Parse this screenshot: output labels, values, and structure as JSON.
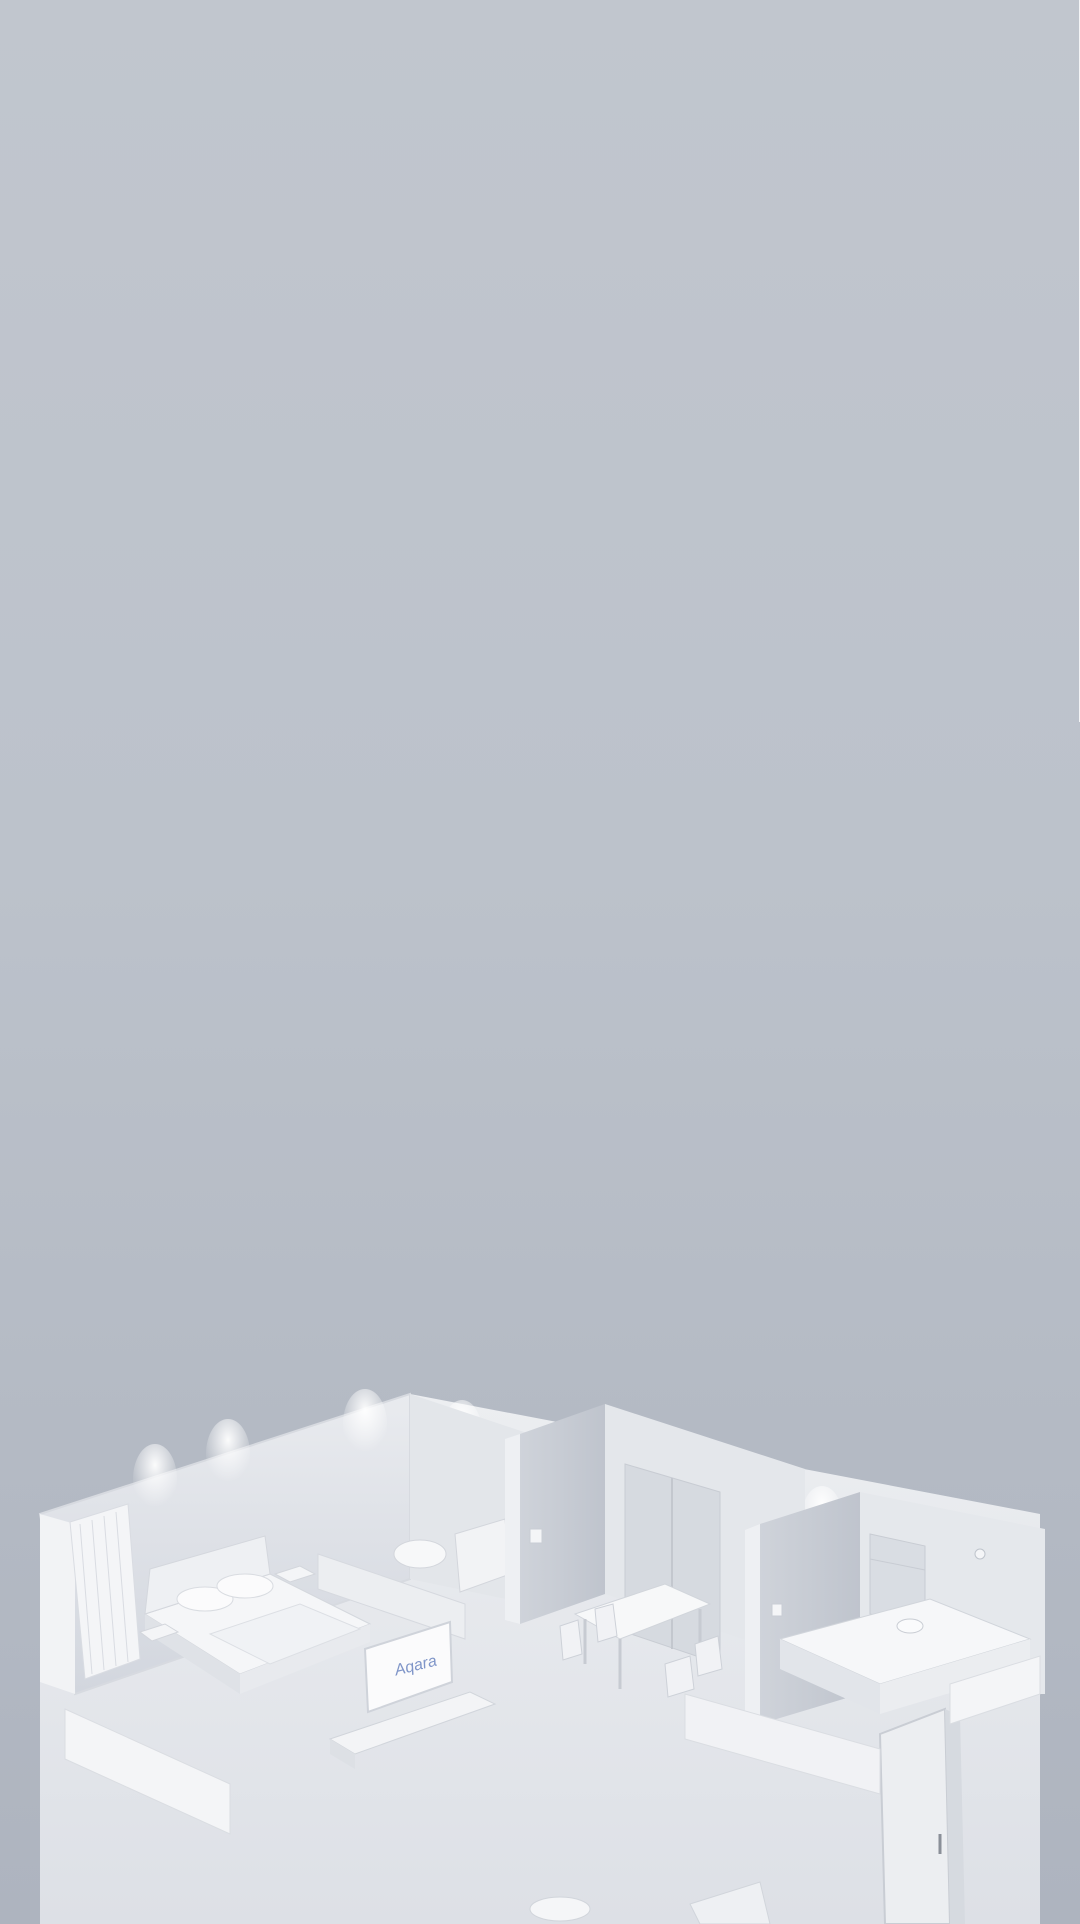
{
  "screen": {
    "name": "splash-screen",
    "background_top": "#c1c6ce",
    "background_bottom": "#aeb4bf"
  },
  "illustration": {
    "description_name": "isometric-smart-home-floorplan",
    "tv_brand_text": "Aqara",
    "accent_color": "#7f95c8"
  }
}
